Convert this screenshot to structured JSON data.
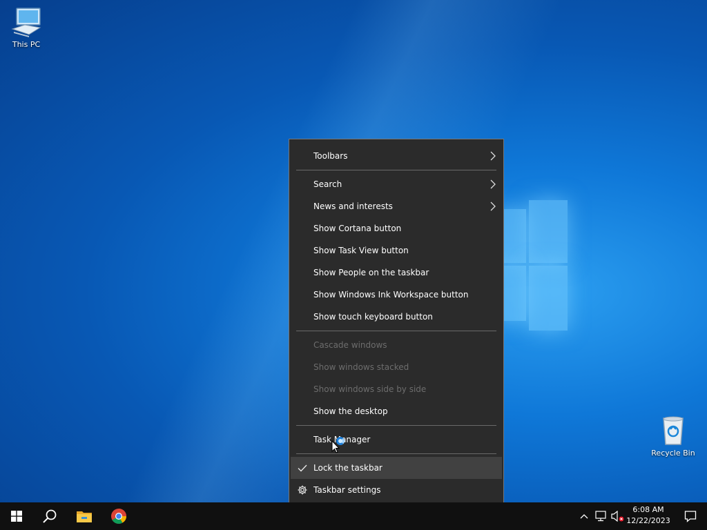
{
  "desktop": {
    "icons": [
      {
        "label": "This PC",
        "icon": "computer-icon"
      },
      {
        "label": "Recycle Bin",
        "icon": "recycle-bin-icon"
      }
    ]
  },
  "context_menu": {
    "items": [
      {
        "label": "Toolbars",
        "submenu": true,
        "enabled": true
      },
      {
        "label": "Search",
        "submenu": true,
        "enabled": true
      },
      {
        "label": "News and interests",
        "submenu": true,
        "enabled": true
      },
      {
        "label": "Show Cortana button",
        "enabled": true
      },
      {
        "label": "Show Task View button",
        "enabled": true
      },
      {
        "label": "Show People on the taskbar",
        "enabled": true
      },
      {
        "label": "Show Windows Ink Workspace button",
        "enabled": true
      },
      {
        "label": "Show touch keyboard button",
        "enabled": true
      },
      {
        "label": "Cascade windows",
        "enabled": false
      },
      {
        "label": "Show windows stacked",
        "enabled": false
      },
      {
        "label": "Show windows side by side",
        "enabled": false
      },
      {
        "label": "Show the desktop",
        "enabled": true
      },
      {
        "label": "Task Manager",
        "enabled": true
      },
      {
        "label": "Lock the taskbar",
        "enabled": true,
        "checked": true
      },
      {
        "label": "Taskbar settings",
        "enabled": true,
        "icon": "gear-icon"
      }
    ]
  },
  "taskbar": {
    "pinned": [
      {
        "icon": "windows-start-icon"
      },
      {
        "icon": "search-icon"
      },
      {
        "icon": "file-explorer-icon"
      },
      {
        "icon": "chrome-icon"
      }
    ],
    "tray": {
      "icons": [
        "chevron-up-icon",
        "network-icon",
        "volume-muted-icon",
        "notification-icon"
      ],
      "time": "6:08 AM",
      "date": "12/22/2023"
    }
  },
  "colors": {
    "menu_bg": "#2b2b2b",
    "menu_hover": "#414141",
    "disabled_text": "#6d6d6d",
    "taskbar_bg": "#101010",
    "desktop_blue": "#0f78d8"
  }
}
